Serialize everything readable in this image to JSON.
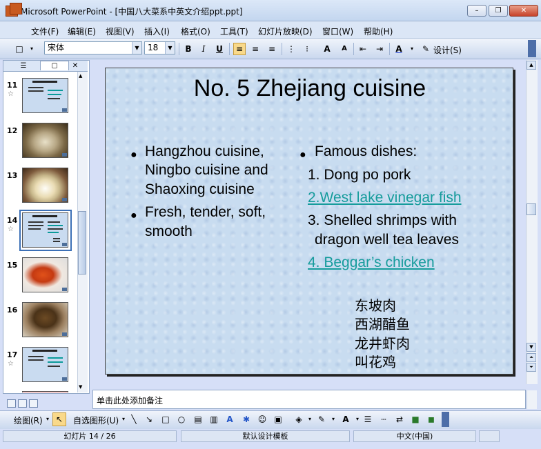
{
  "window": {
    "title": "Microsoft PowerPoint - [中国八大菜系中英文介绍ppt.ppt]",
    "minimize": "–",
    "restore": "❐",
    "close": "✕"
  },
  "menu": [
    "文件(F)",
    "编辑(E)",
    "视图(V)",
    "插入(I)",
    "格式(O)",
    "工具(T)",
    "幻灯片放映(D)",
    "窗口(W)",
    "帮助(H)"
  ],
  "toolbar": {
    "font_name": "宋体",
    "font_size": "18",
    "bold": "B",
    "italic": "I",
    "underline": "U",
    "design_label": "设计(S)"
  },
  "slides_panel": {
    "tab_outline": "☰",
    "tab_slides": "▢",
    "close": "✕",
    "numbers": [
      "11",
      "12",
      "13",
      "14",
      "15",
      "16",
      "17"
    ]
  },
  "slide": {
    "title": "No. 5 Zhejiang cuisine",
    "left_bullets": [
      {
        "lines": [
          "Hangzhou cuisine,",
          "Ningbo cuisine and",
          "Shaoxing cuisine"
        ]
      },
      {
        "lines": [
          "Fresh, tender, soft,",
          "smooth"
        ]
      }
    ],
    "right_heading": "Famous dishes:",
    "dishes": [
      "1. Dong po pork",
      "2.West lake vinegar fish",
      "3. Shelled shrimps with",
      "dragon well tea leaves",
      "4. Beggar’s chicken"
    ],
    "chinese_names": [
      "东坡肉",
      "西湖醋鱼",
      "龙井虾肉",
      "叫花鸡"
    ]
  },
  "notes": {
    "placeholder": "单击此处添加备注"
  },
  "drawing": {
    "draw_label": "绘图(R)",
    "autoshape_label": "自选图形(U)"
  },
  "status": {
    "slide": "幻灯片 14 / 26",
    "template": "默认设计模板",
    "language": "中文(中国)"
  }
}
